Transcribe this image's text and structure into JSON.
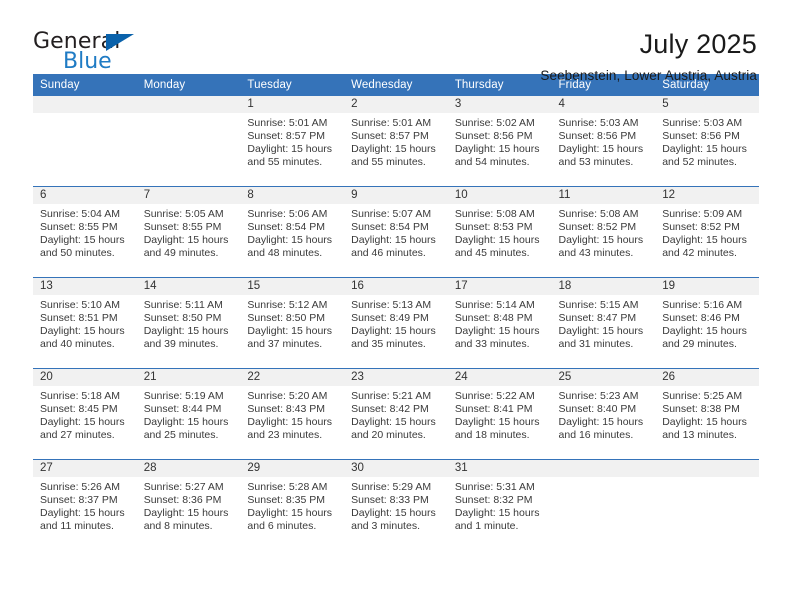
{
  "brand": {
    "name_part1": "General",
    "name_part2": "Blue",
    "triangle_icon": "triangle-icon",
    "accent_dark": "#231f20",
    "accent_blue": "#1f7bc4",
    "triangle_blue": "#0a62ab"
  },
  "header": {
    "title": "July 2025",
    "subtitle": "Seebenstein, Lower Austria, Austria",
    "header_bg": "#3573b9",
    "daynum_bg": "#f1f1f1"
  },
  "calendar": {
    "weekday_headers": [
      "Sunday",
      "Monday",
      "Tuesday",
      "Wednesday",
      "Thursday",
      "Friday",
      "Saturday"
    ],
    "weeks": [
      [
        {
          "day": "",
          "blank": true,
          "sunrise": "",
          "sunset": "",
          "daylight_line1": "",
          "daylight_line2": ""
        },
        {
          "day": "",
          "blank": true,
          "sunrise": "",
          "sunset": "",
          "daylight_line1": "",
          "daylight_line2": ""
        },
        {
          "day": "1",
          "blank": false,
          "sunrise": "Sunrise: 5:01 AM",
          "sunset": "Sunset: 8:57 PM",
          "daylight_line1": "Daylight: 15 hours",
          "daylight_line2": "and 55 minutes."
        },
        {
          "day": "2",
          "blank": false,
          "sunrise": "Sunrise: 5:01 AM",
          "sunset": "Sunset: 8:57 PM",
          "daylight_line1": "Daylight: 15 hours",
          "daylight_line2": "and 55 minutes."
        },
        {
          "day": "3",
          "blank": false,
          "sunrise": "Sunrise: 5:02 AM",
          "sunset": "Sunset: 8:56 PM",
          "daylight_line1": "Daylight: 15 hours",
          "daylight_line2": "and 54 minutes."
        },
        {
          "day": "4",
          "blank": false,
          "sunrise": "Sunrise: 5:03 AM",
          "sunset": "Sunset: 8:56 PM",
          "daylight_line1": "Daylight: 15 hours",
          "daylight_line2": "and 53 minutes."
        },
        {
          "day": "5",
          "blank": false,
          "sunrise": "Sunrise: 5:03 AM",
          "sunset": "Sunset: 8:56 PM",
          "daylight_line1": "Daylight: 15 hours",
          "daylight_line2": "and 52 minutes."
        }
      ],
      [
        {
          "day": "6",
          "blank": false,
          "sunrise": "Sunrise: 5:04 AM",
          "sunset": "Sunset: 8:55 PM",
          "daylight_line1": "Daylight: 15 hours",
          "daylight_line2": "and 50 minutes."
        },
        {
          "day": "7",
          "blank": false,
          "sunrise": "Sunrise: 5:05 AM",
          "sunset": "Sunset: 8:55 PM",
          "daylight_line1": "Daylight: 15 hours",
          "daylight_line2": "and 49 minutes."
        },
        {
          "day": "8",
          "blank": false,
          "sunrise": "Sunrise: 5:06 AM",
          "sunset": "Sunset: 8:54 PM",
          "daylight_line1": "Daylight: 15 hours",
          "daylight_line2": "and 48 minutes."
        },
        {
          "day": "9",
          "blank": false,
          "sunrise": "Sunrise: 5:07 AM",
          "sunset": "Sunset: 8:54 PM",
          "daylight_line1": "Daylight: 15 hours",
          "daylight_line2": "and 46 minutes."
        },
        {
          "day": "10",
          "blank": false,
          "sunrise": "Sunrise: 5:08 AM",
          "sunset": "Sunset: 8:53 PM",
          "daylight_line1": "Daylight: 15 hours",
          "daylight_line2": "and 45 minutes."
        },
        {
          "day": "11",
          "blank": false,
          "sunrise": "Sunrise: 5:08 AM",
          "sunset": "Sunset: 8:52 PM",
          "daylight_line1": "Daylight: 15 hours",
          "daylight_line2": "and 43 minutes."
        },
        {
          "day": "12",
          "blank": false,
          "sunrise": "Sunrise: 5:09 AM",
          "sunset": "Sunset: 8:52 PM",
          "daylight_line1": "Daylight: 15 hours",
          "daylight_line2": "and 42 minutes."
        }
      ],
      [
        {
          "day": "13",
          "blank": false,
          "sunrise": "Sunrise: 5:10 AM",
          "sunset": "Sunset: 8:51 PM",
          "daylight_line1": "Daylight: 15 hours",
          "daylight_line2": "and 40 minutes."
        },
        {
          "day": "14",
          "blank": false,
          "sunrise": "Sunrise: 5:11 AM",
          "sunset": "Sunset: 8:50 PM",
          "daylight_line1": "Daylight: 15 hours",
          "daylight_line2": "and 39 minutes."
        },
        {
          "day": "15",
          "blank": false,
          "sunrise": "Sunrise: 5:12 AM",
          "sunset": "Sunset: 8:50 PM",
          "daylight_line1": "Daylight: 15 hours",
          "daylight_line2": "and 37 minutes."
        },
        {
          "day": "16",
          "blank": false,
          "sunrise": "Sunrise: 5:13 AM",
          "sunset": "Sunset: 8:49 PM",
          "daylight_line1": "Daylight: 15 hours",
          "daylight_line2": "and 35 minutes."
        },
        {
          "day": "17",
          "blank": false,
          "sunrise": "Sunrise: 5:14 AM",
          "sunset": "Sunset: 8:48 PM",
          "daylight_line1": "Daylight: 15 hours",
          "daylight_line2": "and 33 minutes."
        },
        {
          "day": "18",
          "blank": false,
          "sunrise": "Sunrise: 5:15 AM",
          "sunset": "Sunset: 8:47 PM",
          "daylight_line1": "Daylight: 15 hours",
          "daylight_line2": "and 31 minutes."
        },
        {
          "day": "19",
          "blank": false,
          "sunrise": "Sunrise: 5:16 AM",
          "sunset": "Sunset: 8:46 PM",
          "daylight_line1": "Daylight: 15 hours",
          "daylight_line2": "and 29 minutes."
        }
      ],
      [
        {
          "day": "20",
          "blank": false,
          "sunrise": "Sunrise: 5:18 AM",
          "sunset": "Sunset: 8:45 PM",
          "daylight_line1": "Daylight: 15 hours",
          "daylight_line2": "and 27 minutes."
        },
        {
          "day": "21",
          "blank": false,
          "sunrise": "Sunrise: 5:19 AM",
          "sunset": "Sunset: 8:44 PM",
          "daylight_line1": "Daylight: 15 hours",
          "daylight_line2": "and 25 minutes."
        },
        {
          "day": "22",
          "blank": false,
          "sunrise": "Sunrise: 5:20 AM",
          "sunset": "Sunset: 8:43 PM",
          "daylight_line1": "Daylight: 15 hours",
          "daylight_line2": "and 23 minutes."
        },
        {
          "day": "23",
          "blank": false,
          "sunrise": "Sunrise: 5:21 AM",
          "sunset": "Sunset: 8:42 PM",
          "daylight_line1": "Daylight: 15 hours",
          "daylight_line2": "and 20 minutes."
        },
        {
          "day": "24",
          "blank": false,
          "sunrise": "Sunrise: 5:22 AM",
          "sunset": "Sunset: 8:41 PM",
          "daylight_line1": "Daylight: 15 hours",
          "daylight_line2": "and 18 minutes."
        },
        {
          "day": "25",
          "blank": false,
          "sunrise": "Sunrise: 5:23 AM",
          "sunset": "Sunset: 8:40 PM",
          "daylight_line1": "Daylight: 15 hours",
          "daylight_line2": "and 16 minutes."
        },
        {
          "day": "26",
          "blank": false,
          "sunrise": "Sunrise: 5:25 AM",
          "sunset": "Sunset: 8:38 PM",
          "daylight_line1": "Daylight: 15 hours",
          "daylight_line2": "and 13 minutes."
        }
      ],
      [
        {
          "day": "27",
          "blank": false,
          "sunrise": "Sunrise: 5:26 AM",
          "sunset": "Sunset: 8:37 PM",
          "daylight_line1": "Daylight: 15 hours",
          "daylight_line2": "and 11 minutes."
        },
        {
          "day": "28",
          "blank": false,
          "sunrise": "Sunrise: 5:27 AM",
          "sunset": "Sunset: 8:36 PM",
          "daylight_line1": "Daylight: 15 hours",
          "daylight_line2": "and 8 minutes."
        },
        {
          "day": "29",
          "blank": false,
          "sunrise": "Sunrise: 5:28 AM",
          "sunset": "Sunset: 8:35 PM",
          "daylight_line1": "Daylight: 15 hours",
          "daylight_line2": "and 6 minutes."
        },
        {
          "day": "30",
          "blank": false,
          "sunrise": "Sunrise: 5:29 AM",
          "sunset": "Sunset: 8:33 PM",
          "daylight_line1": "Daylight: 15 hours",
          "daylight_line2": "and 3 minutes."
        },
        {
          "day": "31",
          "blank": false,
          "sunrise": "Sunrise: 5:31 AM",
          "sunset": "Sunset: 8:32 PM",
          "daylight_line1": "Daylight: 15 hours",
          "daylight_line2": "and 1 minute."
        },
        {
          "day": "",
          "blank": true,
          "sunrise": "",
          "sunset": "",
          "daylight_line1": "",
          "daylight_line2": ""
        },
        {
          "day": "",
          "blank": true,
          "sunrise": "",
          "sunset": "",
          "daylight_line1": "",
          "daylight_line2": ""
        }
      ]
    ]
  }
}
